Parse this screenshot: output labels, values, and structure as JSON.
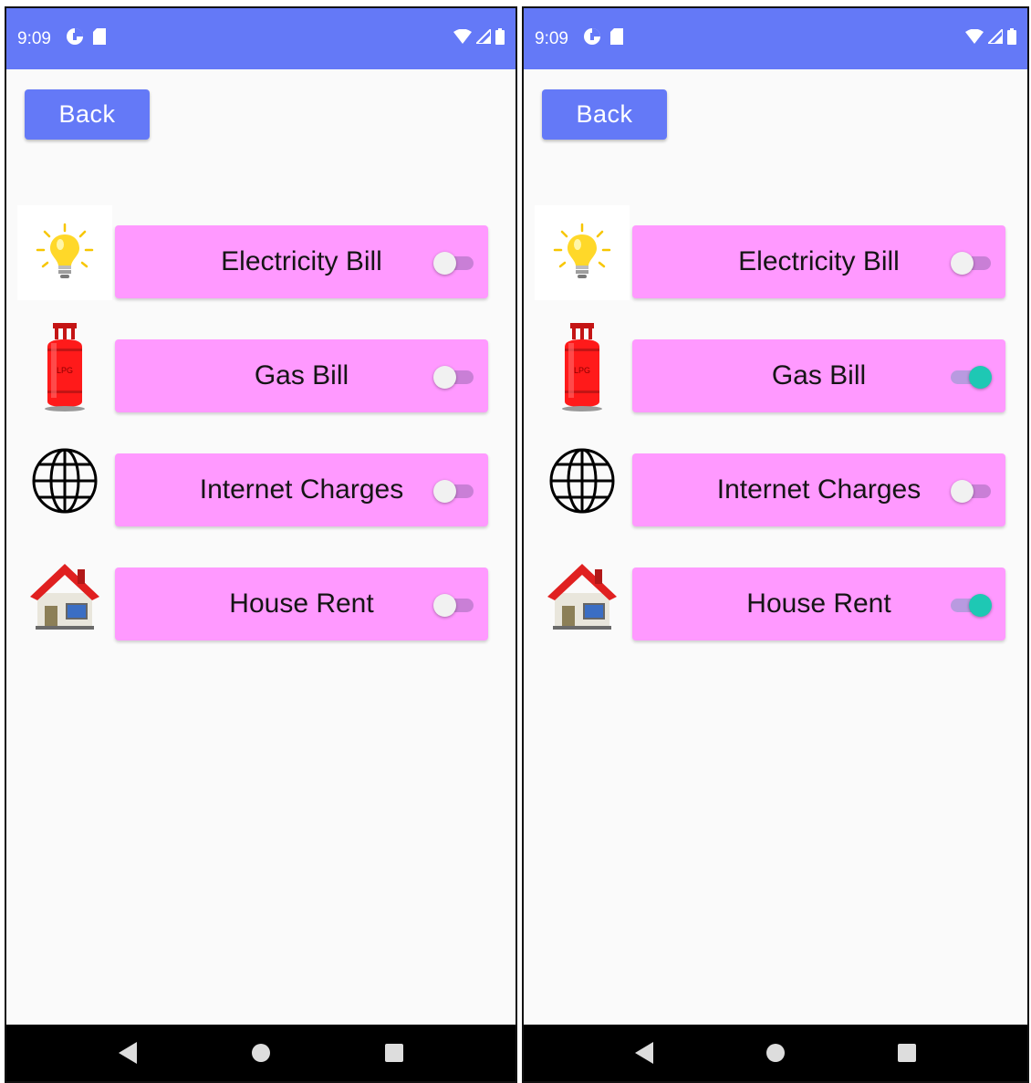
{
  "screens": [
    {
      "status": {
        "time": "9:09"
      },
      "back_label": "Back",
      "bills": [
        {
          "icon": "light-bulb-icon",
          "label": "Electricity Bill",
          "enabled": false
        },
        {
          "icon": "gas-cylinder-icon",
          "label": "Gas Bill",
          "enabled": false,
          "badge": "LPG"
        },
        {
          "icon": "globe-icon",
          "label": "Internet Charges",
          "enabled": false
        },
        {
          "icon": "house-icon",
          "label": "House Rent",
          "enabled": false
        }
      ]
    },
    {
      "status": {
        "time": "9:09"
      },
      "back_label": "Back",
      "bills": [
        {
          "icon": "light-bulb-icon",
          "label": "Electricity Bill",
          "enabled": false
        },
        {
          "icon": "gas-cylinder-icon",
          "label": "Gas Bill",
          "enabled": true,
          "badge": "LPG"
        },
        {
          "icon": "globe-icon",
          "label": "Internet Charges",
          "enabled": false
        },
        {
          "icon": "house-icon",
          "label": "House Rent",
          "enabled": true
        }
      ]
    }
  ],
  "colors": {
    "accent": "#6479f7",
    "card": "#ff99ff",
    "switch_on": "#1ec8b4",
    "switch_off_track": "#c97fd6"
  }
}
